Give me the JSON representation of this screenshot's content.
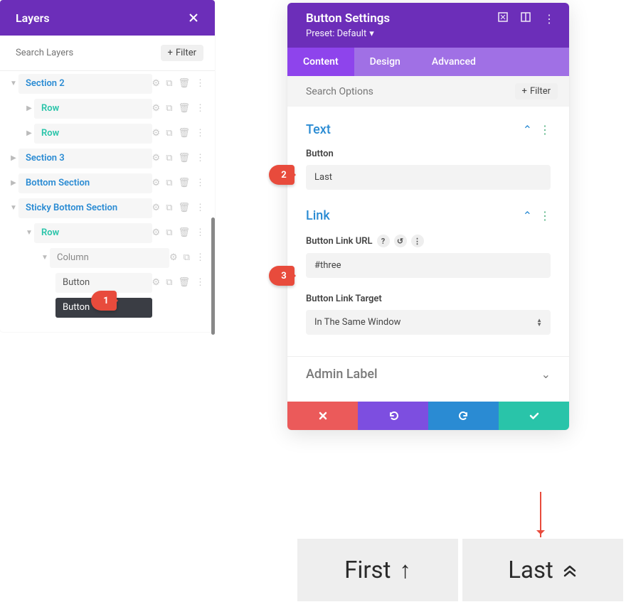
{
  "layers": {
    "title": "Layers",
    "search_placeholder": "Search Layers",
    "filter_label": "Filter",
    "tree": {
      "section2": "Section 2",
      "row": "Row",
      "section3": "Section 3",
      "bottom": "Bottom Section",
      "sticky": "Sticky Bottom Section",
      "column": "Column",
      "button": "Button"
    }
  },
  "settings": {
    "title": "Button Settings",
    "preset": "Preset: Default",
    "tabs": {
      "content": "Content",
      "design": "Design",
      "advanced": "Advanced"
    },
    "search_placeholder": "Search Options",
    "filter_label": "Filter",
    "text": {
      "heading": "Text",
      "button_label": "Button",
      "button_value": "Last"
    },
    "link": {
      "heading": "Link",
      "url_label": "Button Link URL",
      "url_value": "#three",
      "target_label": "Button Link Target",
      "target_value": "In The Same Window"
    },
    "admin_label": "Admin Label"
  },
  "badges": {
    "b1": "1",
    "b2": "2",
    "b3": "3"
  },
  "preview": {
    "first": "First",
    "last": "Last"
  }
}
